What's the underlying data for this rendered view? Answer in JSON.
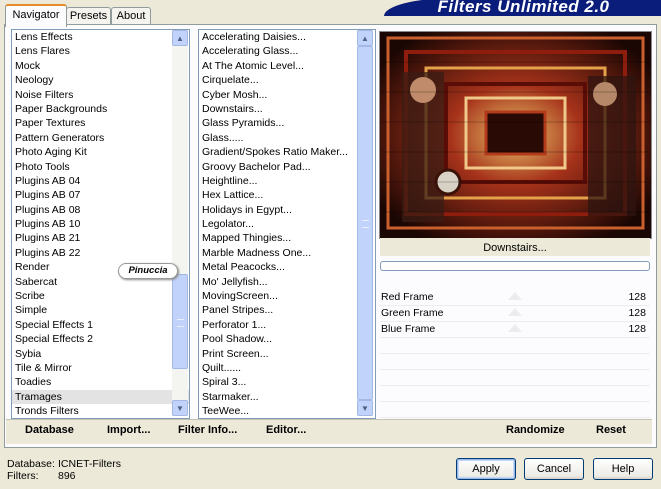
{
  "banner_title": "Filters Unlimited 2.0",
  "tabs": [
    {
      "label": "Navigator",
      "active": true
    },
    {
      "label": "Presets",
      "active": false
    },
    {
      "label": "About",
      "active": false
    }
  ],
  "categories": [
    "Lens Effects",
    "Lens Flares",
    "Mock",
    "Neology",
    "Noise Filters",
    "Paper Backgrounds",
    "Paper Textures",
    "Pattern Generators",
    "Photo Aging Kit",
    "Photo Tools",
    "Plugins AB 04",
    "Plugins AB 07",
    "Plugins AB 08",
    "Plugins AB 10",
    "Plugins AB 21",
    "Plugins AB 22",
    "Render",
    "Sabercat",
    "Scribe",
    "Simple",
    "Special Effects 1",
    "Special Effects 2",
    "Sybia",
    "Tile & Mirror",
    "Toadies",
    "Tramages",
    "Tronds Filters"
  ],
  "selected_category": "Tramages",
  "watermark": "Pinuccia",
  "filters": [
    "Accelerating Daisies...",
    "Accelerating Glass...",
    "At The Atomic Level...",
    "Cirquelate...",
    "Cyber Mosh...",
    "Downstairs...",
    "Glass Pyramids...",
    "Glass.....",
    "Gradient/Spokes Ratio Maker...",
    "Groovy Bachelor Pad...",
    "Heightline...",
    "Hex Lattice...",
    "Holidays in Egypt...",
    "Legolator...",
    "Mapped Thingies...",
    "Marble Madness One...",
    "Metal Peacocks...",
    "Mo' Jellyfish...",
    "MovingScreen...",
    "Panel Stripes...",
    "Perforator 1...",
    "Pool Shadow...",
    "Print Screen...",
    "Quilt......",
    "Spiral 3...",
    "Starmaker...",
    "TeeWee..."
  ],
  "selected_filter": "Downstairs...",
  "footer_buttons": {
    "database": "Database",
    "import": "Import...",
    "filter_info": "Filter Info...",
    "editor": "Editor...",
    "randomize": "Randomize",
    "reset": "Reset"
  },
  "preview_filter_name": "Downstairs...",
  "sliders": [
    {
      "label": "Red Frame",
      "value": "128"
    },
    {
      "label": "Green Frame",
      "value": "128"
    },
    {
      "label": "Blue Frame",
      "value": "128"
    }
  ],
  "status": {
    "database_label": "Database:",
    "database_value": "ICNET-Filters",
    "filters_label": "Filters:",
    "filters_value": "896"
  },
  "dialog_buttons": {
    "apply": "Apply",
    "cancel": "Cancel",
    "help": "Help"
  }
}
